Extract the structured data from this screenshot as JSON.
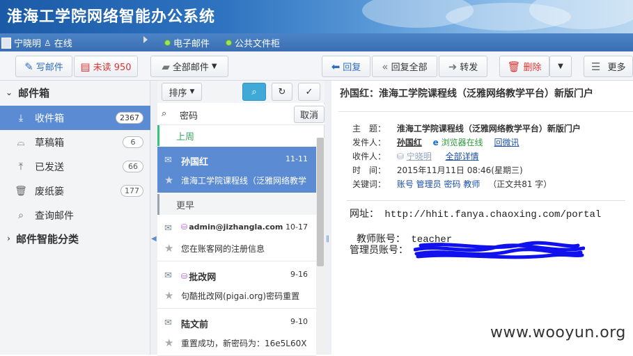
{
  "app": {
    "title": "淮海工学院网络智能办公系统"
  },
  "userbar": {
    "user_name": "宁晓明",
    "user_status": "在线",
    "nav_items": [
      "电子邮件",
      "公共文件柜"
    ]
  },
  "toolbar": {
    "compose": "写邮件",
    "unread": "未读 950",
    "all_mail": "全部邮件",
    "reply": "回复",
    "reply_all": "回复全部",
    "forward": "转发",
    "delete": "删除",
    "more": "更多"
  },
  "sidebar": {
    "mailbox_header": "邮件箱",
    "items": [
      {
        "label": "收件箱",
        "count": "2367",
        "icon": "inbox-icon"
      },
      {
        "label": "草稿箱",
        "count": "6",
        "icon": "drafts-icon"
      },
      {
        "label": "已发送",
        "count": "66",
        "icon": "sent-icon"
      },
      {
        "label": "废纸篓",
        "count": "177",
        "icon": "trash-icon"
      },
      {
        "label": "查询邮件",
        "count": "",
        "icon": "search-mail-icon"
      }
    ],
    "smart_header": "邮件智能分类"
  },
  "listpanel": {
    "sort_label": "排序",
    "search_value": "密码",
    "cancel_label": "取消",
    "section_recent": "上周",
    "section_earlier": "更早",
    "mails": [
      {
        "sender": "孙国红",
        "date": "11-11",
        "subject": "淮海工学院课程线（泛雅网络教学"
      },
      {
        "sender": "admin@jizhangla.com",
        "date": "10-17",
        "subject": "您在账客网的注册信息"
      },
      {
        "sender": "批改网",
        "date": "9-16",
        "subject": "句酷批改网(pigai.org)密码重置"
      },
      {
        "sender": "陆文前",
        "date": "9-10",
        "subject": "重置成功，新密码为：16e5L60X"
      }
    ]
  },
  "reading": {
    "title": "孙国红：淮海工学院课程线（泛雅网络教学平台）新版门户",
    "subject_label": "主　题：",
    "subject_value": "淮海工学院课程线（泛雅网络教学平台）新版门户",
    "from_label": "发件人：",
    "from_value": "孙国红",
    "browser_online": "浏览器在线",
    "reply_thanks": "回微讯",
    "to_label": "收件人：",
    "to_value": "宁晓明",
    "all_detail": "全部详情",
    "time_label": "时　间：",
    "time_value": "2015年11月11日 08:46(星期三)",
    "keywords_label": "关键词：",
    "keywords": [
      "账号",
      "管理员",
      "密码",
      "教师"
    ],
    "word_count": "（正文共81 字）",
    "body_line1": "网址：  http://hhit.fanya.chaoxing.com/portal",
    "body_line2": "教师账号：  teacher",
    "body_line3": "管理员账号："
  },
  "watermark": "www.wooyun.org",
  "colors": {
    "accent_blue": "#5b8bd2",
    "link": "#1a4fa8",
    "unread_red": "#d33",
    "online_green": "#2a9b3a",
    "redact_blue": "#1111ee"
  }
}
